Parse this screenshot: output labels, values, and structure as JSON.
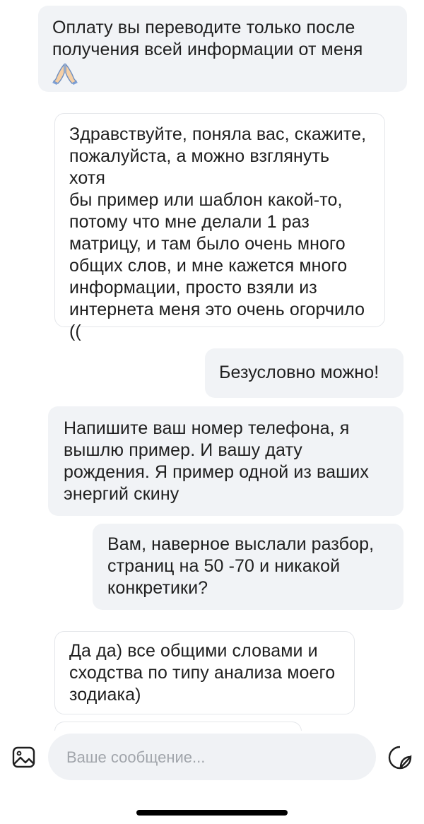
{
  "messages": [
    {
      "id": "msg1",
      "text": "Оплату вы переводите только после\nполучения всей информации от меня",
      "emoji": "folded-hands"
    },
    {
      "id": "msg2",
      "text": "Здравствуйте, поняла вас, скажите,\nпожалуйста, а можно взглянуть хотя\nбы пример или шаблон какой-то,\nпотому что мне делали 1 раз\nматрицу, и там было очень много\nобщих слов, и мне кажется много\nинформации, просто взяли из\nинтернета меня это очень огорчило\n(("
    },
    {
      "id": "msg3",
      "text": "Безусловно можно!"
    },
    {
      "id": "msg4",
      "text": "Напишите ваш номер телефона, я\nвышлю пример. И вашу дату\nрождения. Я пример одной из ваших\nэнергий скину"
    },
    {
      "id": "msg5",
      "text": "Вам, наверное выслали разбор,\nстраниц на 50 -70 и никакой\nконкретики?"
    },
    {
      "id": "msg6",
      "text": "Да да) все общими словами и\nсходства по типу анализа моего\nзодиака)"
    }
  ],
  "composer": {
    "placeholder": "Ваше сообщение...",
    "value": ""
  },
  "icons": {
    "gallery": "gallery-icon",
    "sticker": "sticker-icon"
  },
  "colors": {
    "bubble_fill": "#f1f3f6",
    "bubble_border": "#e4e6ea",
    "text": "#1f1f1f",
    "placeholder": "#a1a5ab"
  }
}
